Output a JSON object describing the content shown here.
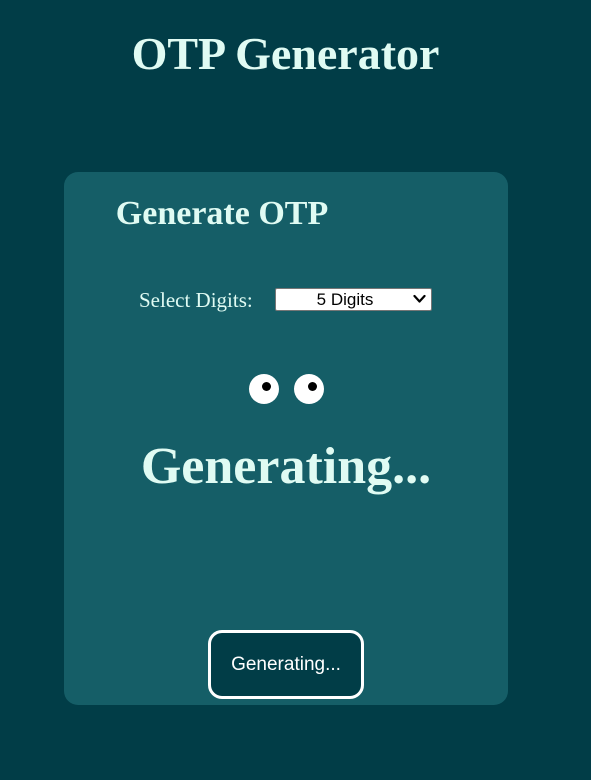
{
  "page": {
    "title": "OTP Generator",
    "background_color": "#013d47"
  },
  "card": {
    "title": "Generate OTP",
    "background_color": "#155e67",
    "digits_label": "Select Digits:",
    "digits_select": {
      "selected": "5 Digits",
      "icon": "chevron-down-icon"
    },
    "eyes": {
      "icon": "eyes-icon",
      "count": 2
    },
    "status_text": "Generating...",
    "button": {
      "label": "Generating...",
      "border_color": "#ffffff"
    }
  },
  "colors": {
    "text": "#e0fbf3"
  }
}
